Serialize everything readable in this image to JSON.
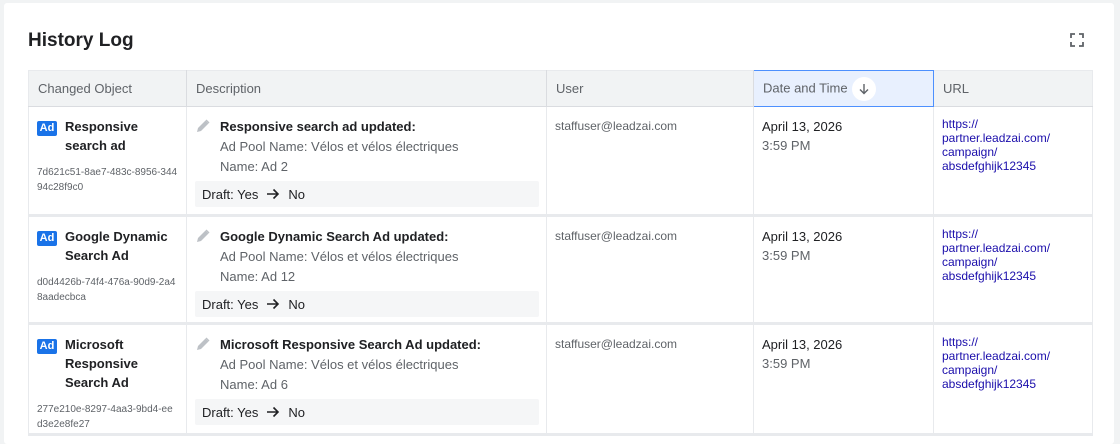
{
  "page": {
    "title": "History Log"
  },
  "table": {
    "columns": {
      "changed_object": "Changed Object",
      "description": "Description",
      "user": "User",
      "date_time": "Date and Time",
      "url": "URL"
    },
    "sort": {
      "column": "Date and Time",
      "direction": "descending"
    },
    "rows": [
      {
        "badge": "Ad",
        "object_name": [
          "Responsive",
          "search ad"
        ],
        "object_id": "7d621c51-8ae7-483c-8956-34494c28f9c0",
        "desc_title": "Responsive search ad updated:",
        "pool": "Ad Pool Name: Vélos et vélos électriques",
        "name": "Name: Ad 2",
        "draft_label": "Draft: Yes",
        "draft_to": "No",
        "user": "staffuser@leadzai.com",
        "date": "April 13, 2026",
        "time": "3:59 PM",
        "url": [
          "https://",
          "partner.leadzai.com/",
          "campaign/",
          "absdefghijk12345"
        ]
      },
      {
        "badge": "Ad",
        "object_name": [
          "Google Dynamic",
          "Search Ad"
        ],
        "object_id": "d0d4426b-74f4-476a-90d9-2a48aadecbca",
        "desc_title": "Google Dynamic Search Ad updated:",
        "pool": "Ad Pool Name: Vélos et vélos électriques",
        "name": "Name: Ad 12",
        "draft_label": "Draft: Yes",
        "draft_to": "No",
        "user": "staffuser@leadzai.com",
        "date": "April 13, 2026",
        "time": "3:59 PM",
        "url": [
          "https://",
          "partner.leadzai.com/",
          "campaign/",
          "absdefghijk12345"
        ]
      },
      {
        "badge": "Ad",
        "object_name": [
          "Microsoft",
          "Responsive",
          "Search Ad"
        ],
        "object_id": "277e210e-8297-4aa3-9bd4-eed3e2e8fe27",
        "desc_title": "Microsoft Responsive Search Ad updated:",
        "pool": "Ad Pool Name: Vélos et vélos électriques",
        "name": "Name: Ad 6",
        "draft_label": "Draft: Yes",
        "draft_to": "No",
        "user": "staffuser@leadzai.com",
        "date": "April 13, 2026",
        "time": "3:59 PM",
        "url": [
          "https://",
          "partner.leadzai.com/",
          "campaign/",
          "absdefghijk12345"
        ]
      }
    ]
  },
  "icons": {
    "expand": "fullscreen-icon",
    "sort": "arrow-down-icon",
    "edit": "pencil-icon",
    "change": "arrow-right-icon"
  }
}
